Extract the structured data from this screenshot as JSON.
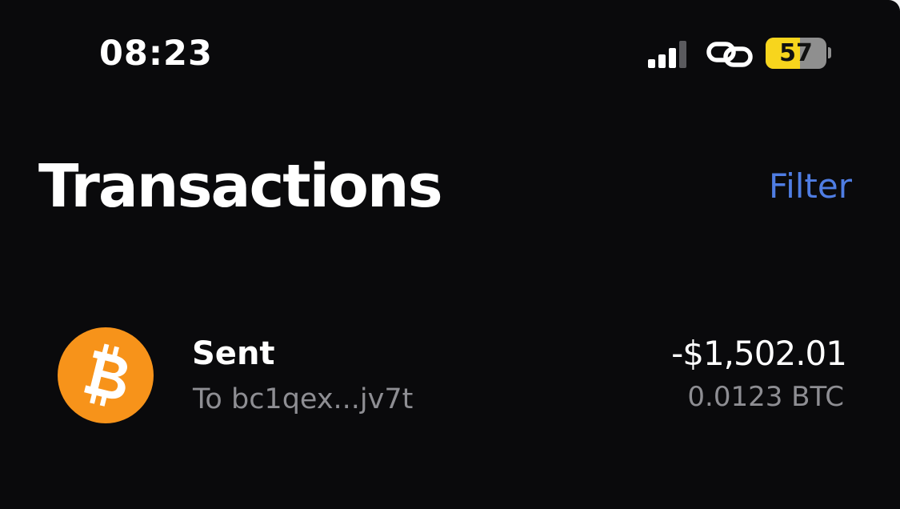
{
  "status_bar": {
    "time": "08:23",
    "battery_level": "57",
    "battery_fraction": 0.57,
    "signal_icon": "cellular-signal-icon",
    "hotspot_icon": "personal-hotspot-icon",
    "battery_icon": "battery-icon"
  },
  "header": {
    "title": "Transactions",
    "filter_label": "Filter"
  },
  "transactions": [
    {
      "icon": "bitcoin-icon",
      "type": "Sent",
      "recipient": "To bc1qex...jv7t",
      "fiat_amount": "-$1,502.01",
      "crypto_amount": "0.0123 BTC"
    }
  ],
  "colors": {
    "background": "#0a0a0c",
    "accent": "#4f7de3",
    "secondary_text": "#8e8e93",
    "bitcoin_orange": "#f7931a",
    "battery_yellow": "#f7d51d"
  }
}
